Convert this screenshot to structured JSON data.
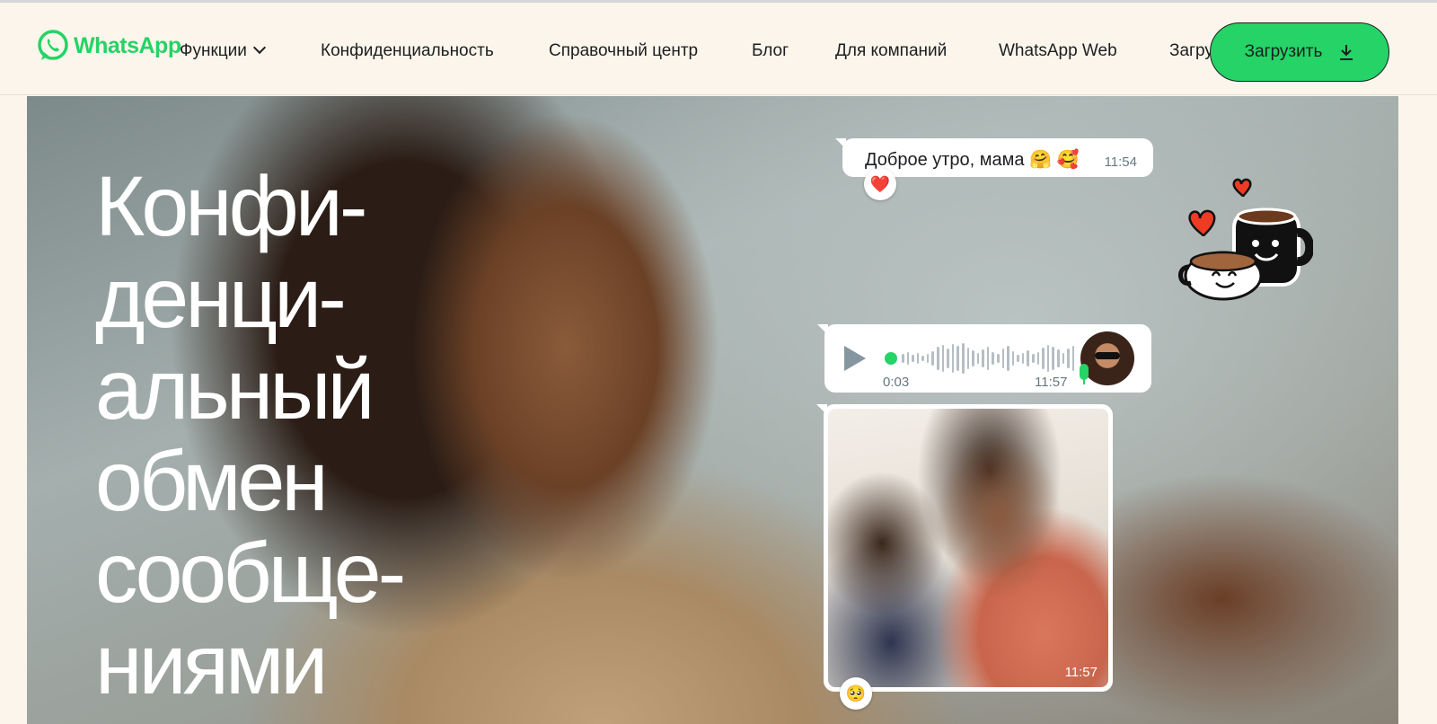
{
  "header": {
    "logo_text": "WhatsApp",
    "nav": [
      {
        "label": "Функции"
      },
      {
        "label": "Конфиденциальность"
      },
      {
        "label": "Справочный центр"
      },
      {
        "label": "Блог"
      },
      {
        "label": "Для компаний"
      },
      {
        "label": "WhatsApp Web"
      },
      {
        "label": "Загрузить"
      }
    ],
    "download_button": "Загрузить"
  },
  "hero": {
    "title_lines": [
      "Конфи-",
      "денци-",
      "альный",
      "обмен",
      "сообще-",
      "ниями"
    ]
  },
  "chat": {
    "message1": {
      "text": "Доброе утро, мама 🤗 🥰",
      "time": "11:54",
      "reaction": "❤️"
    },
    "voice_note": {
      "elapsed": "0:03",
      "time": "11:57"
    },
    "photo_message": {
      "time": "11:57",
      "reaction": "🥺"
    }
  },
  "colors": {
    "brand": "#25d366",
    "background": "#fcf5eb",
    "text": "#1c1e21"
  }
}
